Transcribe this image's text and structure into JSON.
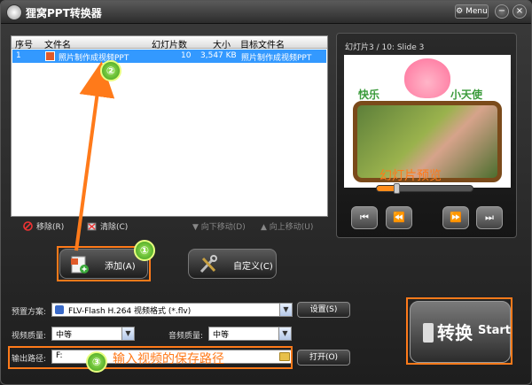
{
  "app": {
    "title": "狸窝PPT转换器",
    "menu_label": "Menu",
    "minimize": "−",
    "close": "×"
  },
  "list": {
    "headers": [
      "序号",
      "文件名",
      "幻灯片数",
      "大小",
      "目标文件名"
    ],
    "rows": [
      {
        "index": "1",
        "file_name": "照片制作成视频PPT",
        "slides": "10",
        "size": "3,547 KB",
        "target_name": "照片制作成视频PPT"
      }
    ]
  },
  "list_toolbar": {
    "remove": "移除(R)",
    "clear": "清除(C)",
    "move_down": "向下移动(D)",
    "move_up": "向上移动(U)"
  },
  "buttons": {
    "add": "添加(A)",
    "customize": "自定义(C)"
  },
  "preview": {
    "title": "幻灯片3 / 10: Slide 3",
    "slide_text_left": "快乐",
    "slide_text_right": "小天使",
    "caption": "幻灯片预览",
    "seek_progress": 0.2
  },
  "settings": {
    "preset_label": "预置方案:",
    "preset_value": "FLV-Flash H.264 视频格式 (*.flv)",
    "settings_button": "设置(S)",
    "video_quality_label": "视频质量:",
    "video_quality_value": "中等",
    "audio_quality_label": "音频质量:",
    "audio_quality_value": "中等",
    "output_label": "输出路径:",
    "output_value": "F:",
    "open_button": "打开(O)"
  },
  "convert": {
    "cn": "转换",
    "en": "Start"
  },
  "annotations": {
    "step1": "①",
    "step2": "②",
    "step3": "③",
    "output_hint": "输入视频的保存路径"
  },
  "colors": {
    "highlight": "#ff7a1a",
    "selection": "#3399ff"
  }
}
